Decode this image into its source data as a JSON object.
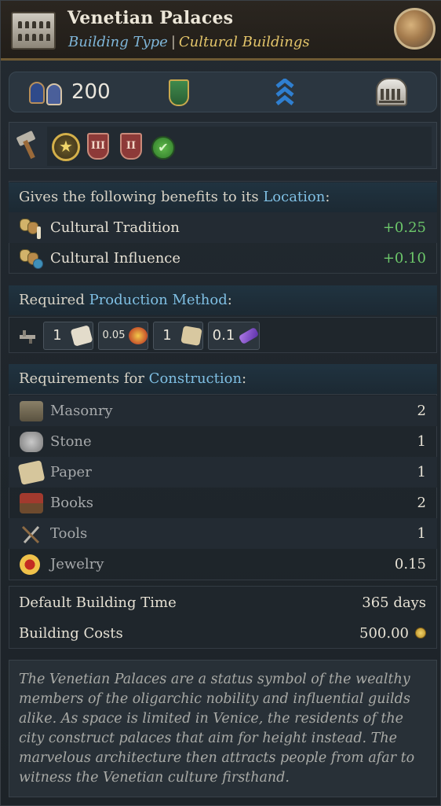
{
  "header": {
    "title": "Venetian Palaces",
    "building_type_label": "Building Type",
    "separator": "|",
    "category": "Cultural Buildings"
  },
  "stats": {
    "population": "200"
  },
  "benefits": {
    "intro_prefix": "Gives the following benefits to its ",
    "intro_link": "Location",
    "intro_suffix": ":",
    "rows": [
      {
        "label": "Cultural Tradition",
        "value": "+0.25",
        "icon": "masks-candle-icon"
      },
      {
        "label": "Cultural Influence",
        "value": "+0.10",
        "icon": "masks-globe-icon"
      }
    ]
  },
  "production": {
    "heading_prefix": "Required ",
    "heading_link": "Production Method",
    "heading_suffix": ":",
    "inputs": [
      {
        "amount": "1",
        "icon": "paper-roll-icon"
      },
      {
        "amount": "0.05",
        "icon": "jewelry-icon"
      },
      {
        "amount": "1",
        "icon": "paper-icon"
      },
      {
        "amount": "0.1",
        "icon": "dye-icon"
      }
    ]
  },
  "requirements": {
    "heading_prefix": "Requirements for ",
    "heading_link": "Construction",
    "heading_suffix": ":",
    "rows": [
      {
        "label": "Masonry",
        "value": "2",
        "icon": "masonry-icon"
      },
      {
        "label": "Stone",
        "value": "1",
        "icon": "stone-icon"
      },
      {
        "label": "Paper",
        "value": "1",
        "icon": "paper-icon"
      },
      {
        "label": "Books",
        "value": "2",
        "icon": "books-icon"
      },
      {
        "label": "Tools",
        "value": "1",
        "icon": "tools-icon"
      },
      {
        "label": "Jewelry",
        "value": "0.15",
        "icon": "jewelry-icon"
      }
    ]
  },
  "building_time": {
    "label": "Default Building Time",
    "value": "365 days"
  },
  "building_costs": {
    "label": "Building Costs",
    "value": "500.00",
    "icon": "gold-coin-icon"
  },
  "description": "The Venetian Palaces are a status symbol of the wealthy members of the oligarchic nobility and influential guilds alike. As space is limited in Venice, the residents of the city construct palaces that aim for height instead. The marvelous architecture then attracts people from afar to witness the Venetian culture firsthand.",
  "colors": {
    "accent_blue": "#7fbfe3",
    "category_gold": "#e4c56a",
    "positive_green": "#6cc76a"
  }
}
